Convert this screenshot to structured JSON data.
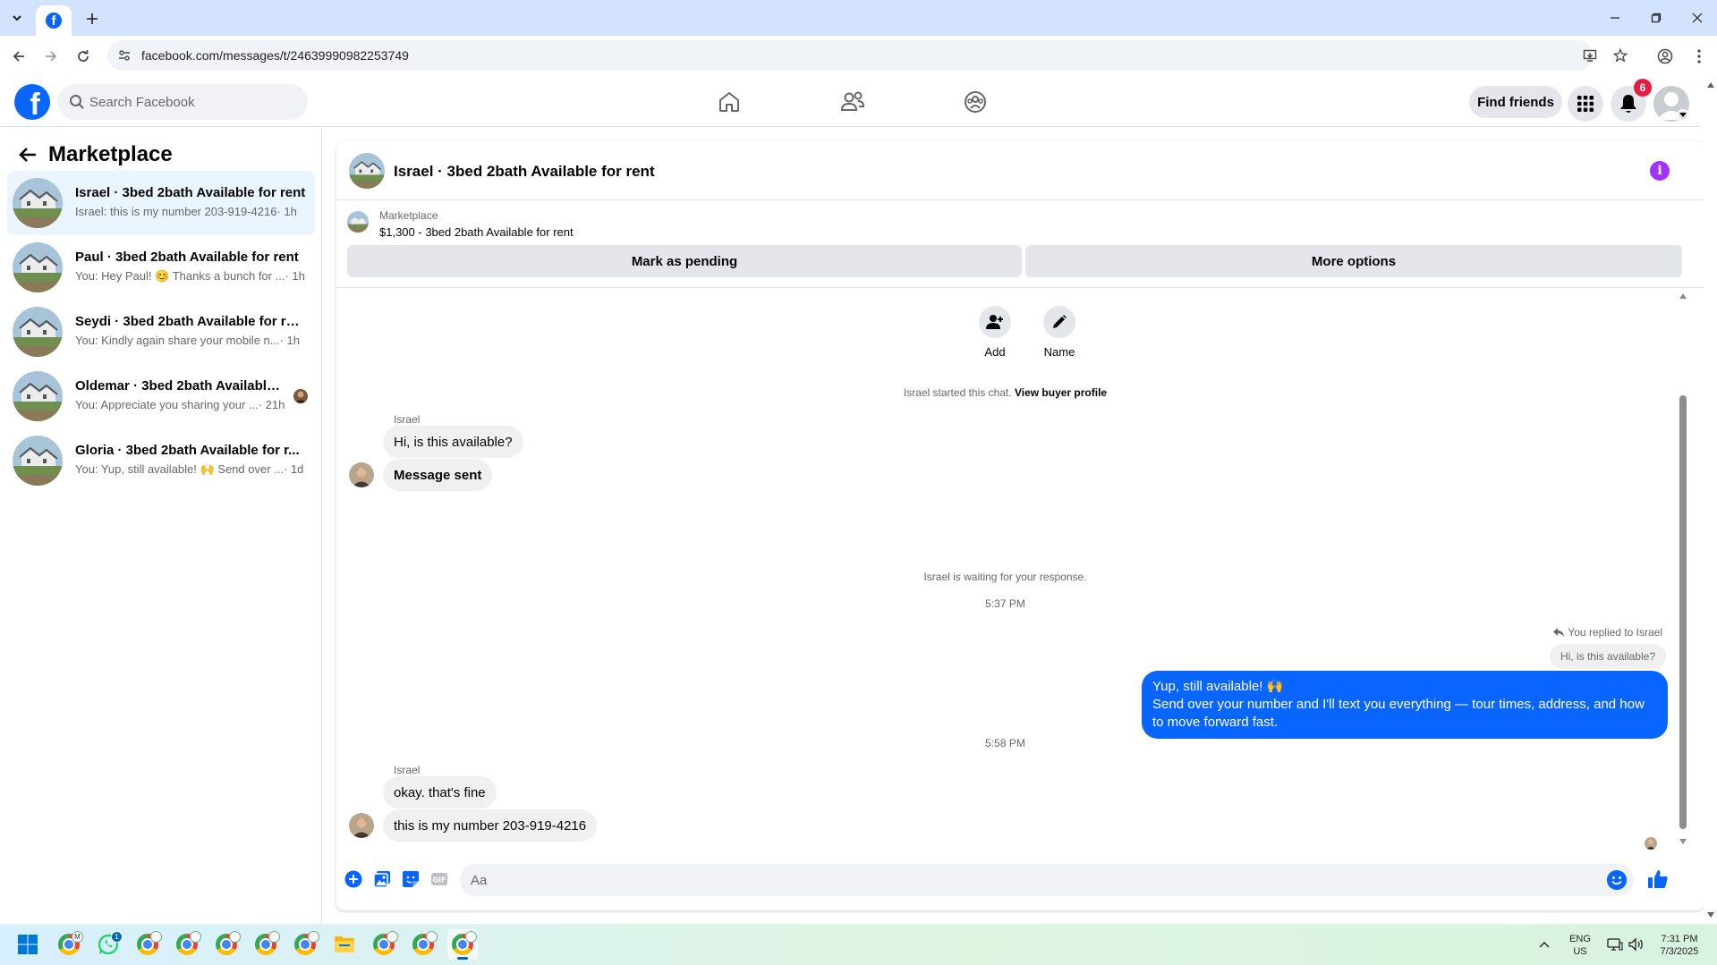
{
  "browser": {
    "url": "facebook.com/messages/t/24639990982253749"
  },
  "fb_nav": {
    "search_placeholder": "Search Facebook",
    "find_friends_label": "Find friends",
    "notification_count": "6"
  },
  "sidebar": {
    "title": "Marketplace",
    "conversations": [
      {
        "title": "Israel · 3bed 2bath Available for rent",
        "preview": "Israel: this is my number 203-919-4216",
        "time": " · 1h"
      },
      {
        "title": "Paul · 3bed 2bath Available for rent",
        "preview": "You: Hey Paul! 😊 Thanks a bunch for ...",
        "time": " · 1h"
      },
      {
        "title": "Seydi · 3bed 2bath Available for rent",
        "preview": "You: Kindly again share your mobile n...",
        "time": " · 1h"
      },
      {
        "title": "Oldemar · 3bed 2bath Available ...",
        "preview": "You: Appreciate you sharing your ...",
        "time": " · 21h"
      },
      {
        "title": "Gloria · 3bed 2bath Available for r...",
        "preview": "You: Yup, still available! 🙌 Send over ...",
        "time": " · 1d"
      }
    ]
  },
  "chat": {
    "title": "Israel · 3bed 2bath Available for rent",
    "listing": {
      "source": "Marketplace",
      "description": "$1,300 - 3bed 2bath Available for rent",
      "mark_pending_label": "Mark as pending",
      "more_options_label": "More options"
    },
    "actions": {
      "add_label": "Add",
      "name_label": "Name"
    },
    "started_text": "Israel started this chat.",
    "view_profile_label": "View buyer profile",
    "sender_name": "Israel",
    "messages_group1": [
      "Hi, is this available?",
      "Message sent"
    ],
    "waiting_text": "Israel is waiting for your response.",
    "time1": "5:37 PM",
    "reply_note": "You replied to Israel",
    "quoted_text": "Hi, is this available?",
    "outgoing_line1": "Yup, still available! 🙌",
    "outgoing_line2": "Send over your number and I'll text you everything — tour times, address, and how to move forward fast.",
    "time2": "5:58 PM",
    "messages_group2": [
      "okay. that's fine",
      "this is my number 203-919-4216"
    ],
    "composer_placeholder": "Aa"
  },
  "taskbar": {
    "lang_line1": "ENG",
    "lang_line2": "US",
    "time": "7:31 PM",
    "date": "7/3/2025",
    "whatsapp_badge": "1"
  }
}
